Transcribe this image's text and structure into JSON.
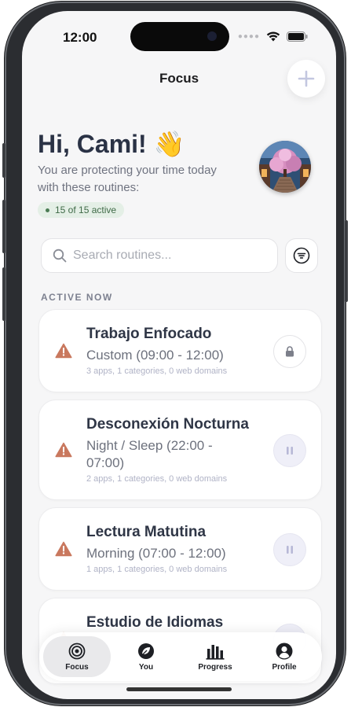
{
  "status_bar": {
    "time": "12:00"
  },
  "header": {
    "title": "Focus"
  },
  "greeting": {
    "title": "Hi, Cami! 👋",
    "subtitle": "You are protecting your time today with these routines:",
    "active_badge": "15 of 15 active"
  },
  "search": {
    "placeholder": "Search routines..."
  },
  "section": {
    "active_now": "ACTIVE NOW"
  },
  "routines": [
    {
      "title": "Trabajo Enfocado",
      "schedule": "Custom (09:00 - 12:00)",
      "meta": "3 apps, 1 categories, 0 web domains",
      "action": "lock-icon"
    },
    {
      "title": "Desconexión Nocturna",
      "schedule": "Night / Sleep (22:00 - 07:00)",
      "meta": "2 apps, 1 categories, 0 web domains",
      "action": "pause-icon"
    },
    {
      "title": "Lectura Matutina",
      "schedule": "Morning (07:00 - 12:00)",
      "meta": "1 apps, 1 categories, 0 web domains",
      "action": "pause-icon"
    },
    {
      "title": "Estudio de Idiomas",
      "schedule": "",
      "meta": "",
      "action": "pause-icon"
    }
  ],
  "tabs": [
    {
      "label": "Focus",
      "icon": "target-icon",
      "active": true
    },
    {
      "label": "You",
      "icon": "leaf-icon",
      "active": false
    },
    {
      "label": "Progress",
      "icon": "bar-chart-icon",
      "active": false
    },
    {
      "label": "Profile",
      "icon": "person-icon",
      "active": false
    }
  ],
  "colors": {
    "heading": "#2a3245",
    "warning": "#c9785e",
    "badge_bg": "#e4efe6",
    "badge_text": "#3f6a47",
    "pause_bg": "#efeff8",
    "accent_plus": "#c3c7e0"
  }
}
